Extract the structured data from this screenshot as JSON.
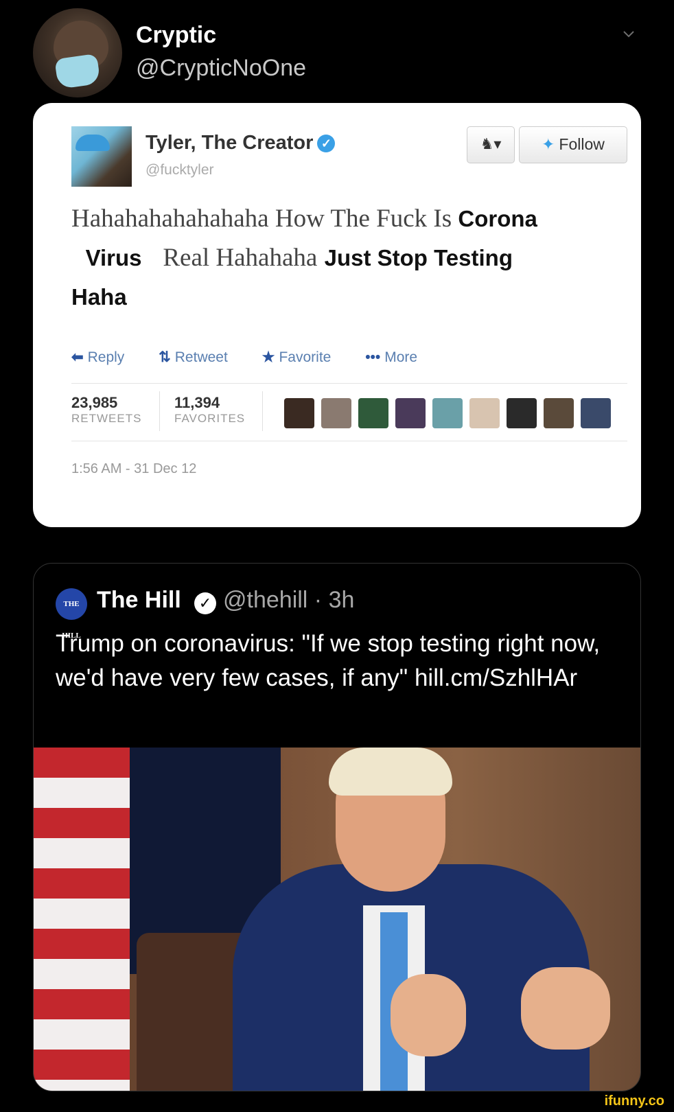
{
  "header": {
    "display_name": "Cryptic",
    "handle": "@CrypticNoOne"
  },
  "embedded_tweet": {
    "author_name": "Tyler, The Creator",
    "author_handle": "@fucktyler",
    "follow_label": "Follow",
    "text_serif_1": "Hahahahahahahaha How The Fuck Is ",
    "text_sans_1": "Corona",
    "text_sans_2": "Virus",
    "text_serif_2": "Real Hahahaha",
    "text_sans_3": "Just Stop Testing",
    "text_sans_4": "Haha",
    "actions": {
      "reply": "Reply",
      "retweet": "Retweet",
      "favorite": "Favorite",
      "more": "More"
    },
    "stats": {
      "retweets_count": "23,985",
      "retweets_label": "RETWEETS",
      "favorites_count": "11,394",
      "favorites_label": "FAVORITES"
    },
    "timestamp": "1:56 AM - 31 Dec 12"
  },
  "quoted_tweet": {
    "logo_text": "THE HILL",
    "author_name": "The Hill",
    "meta": "@thehill · 3h",
    "text": "Trump on coronavirus: \"If we stop testing right now, we'd have very few cases, if any\" hill.cm/SzhlHAr"
  },
  "watermark": "ifunny.co",
  "colors": {
    "background": "#000000",
    "verified_blue": "#3aa0e6",
    "link_blue": "#5a7fb0",
    "hill_blue": "#2446a8"
  },
  "icons": {
    "chevron": "chevron-down-icon",
    "verified": "verified-badge-icon",
    "follow_bird": "twitter-bird-icon",
    "reply": "reply-arrow-icon",
    "retweet": "retweet-icon",
    "favorite": "star-icon",
    "more": "ellipsis-icon"
  }
}
